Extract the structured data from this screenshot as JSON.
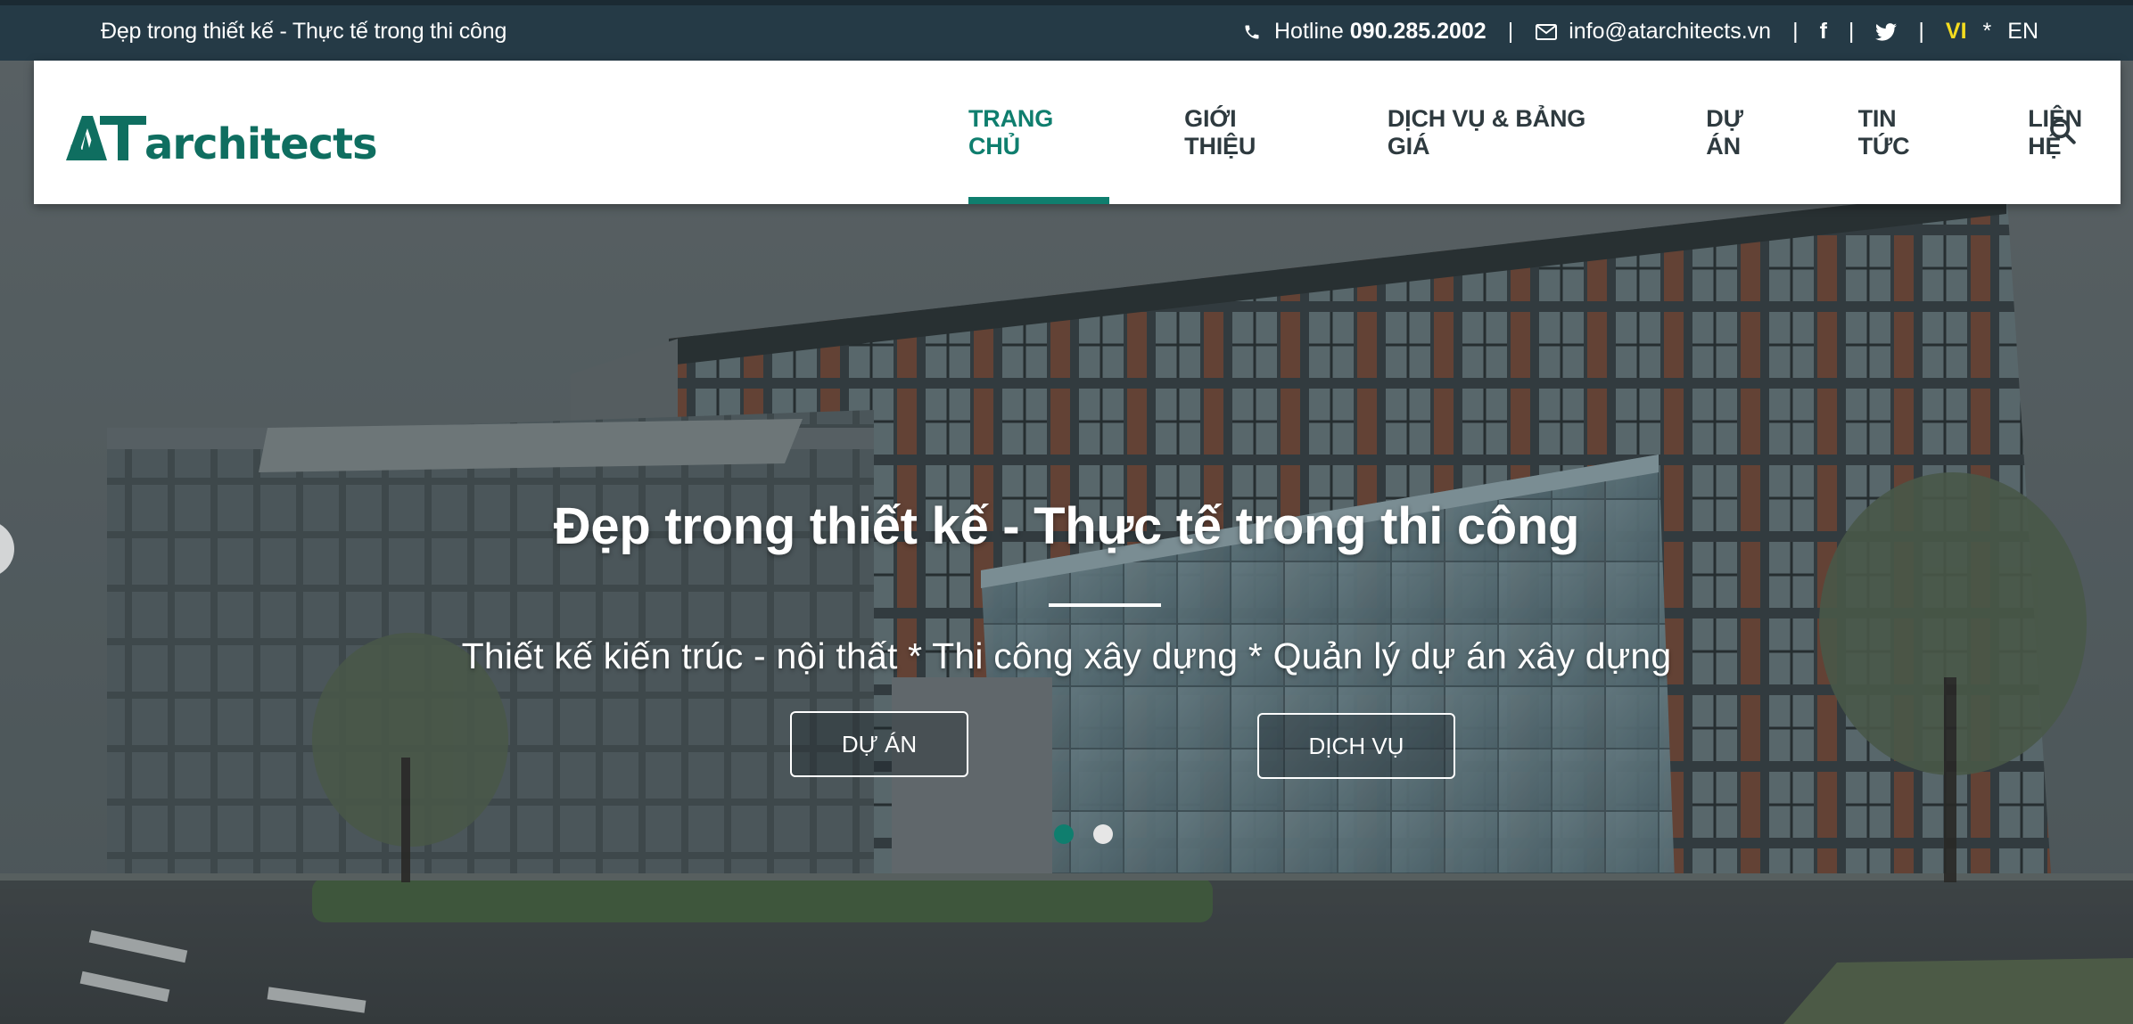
{
  "topbar": {
    "slogan": "Đẹp trong thiết kế - Thực tế trong thi công",
    "hotline_label": "Hotline ",
    "hotline_number": "090.285.2002",
    "separator": "|",
    "email": "info@atarchitects.vn",
    "facebook_glyph": "f",
    "lang_vi": "VI",
    "lang_star": "*",
    "lang_en": "EN"
  },
  "header": {
    "logo_text": "architects",
    "logo_initials": "AT",
    "nav": [
      {
        "label": "TRANG CHỦ",
        "active": true
      },
      {
        "label": "GIỚI THIỆU",
        "active": false
      },
      {
        "label": "DỊCH VỤ & BẢNG GIÁ",
        "active": false
      },
      {
        "label": "DỰ ÁN",
        "active": false
      },
      {
        "label": "TIN TỨC",
        "active": false
      },
      {
        "label": "LIÊN HỆ",
        "active": false
      }
    ]
  },
  "hero": {
    "title": "Đẹp trong thiết kế - Thực tế trong thi công",
    "subtitle": "Thiết kế kiến trúc - nội thất * Thi công xây dựng * Quản lý dự án xây dựng",
    "button_project": "DỰ ÁN",
    "button_service": "DỊCH VỤ",
    "slides_total": 2,
    "slide_active": 1
  },
  "colors": {
    "brand_green": "#0f7e6e",
    "topbar_bg": "#253a46",
    "lang_highlight": "#f4dc1f",
    "nav_text": "#2e3a3f"
  },
  "icons": [
    "phone-icon",
    "mail-icon",
    "facebook-icon",
    "twitter-icon",
    "search-icon"
  ]
}
